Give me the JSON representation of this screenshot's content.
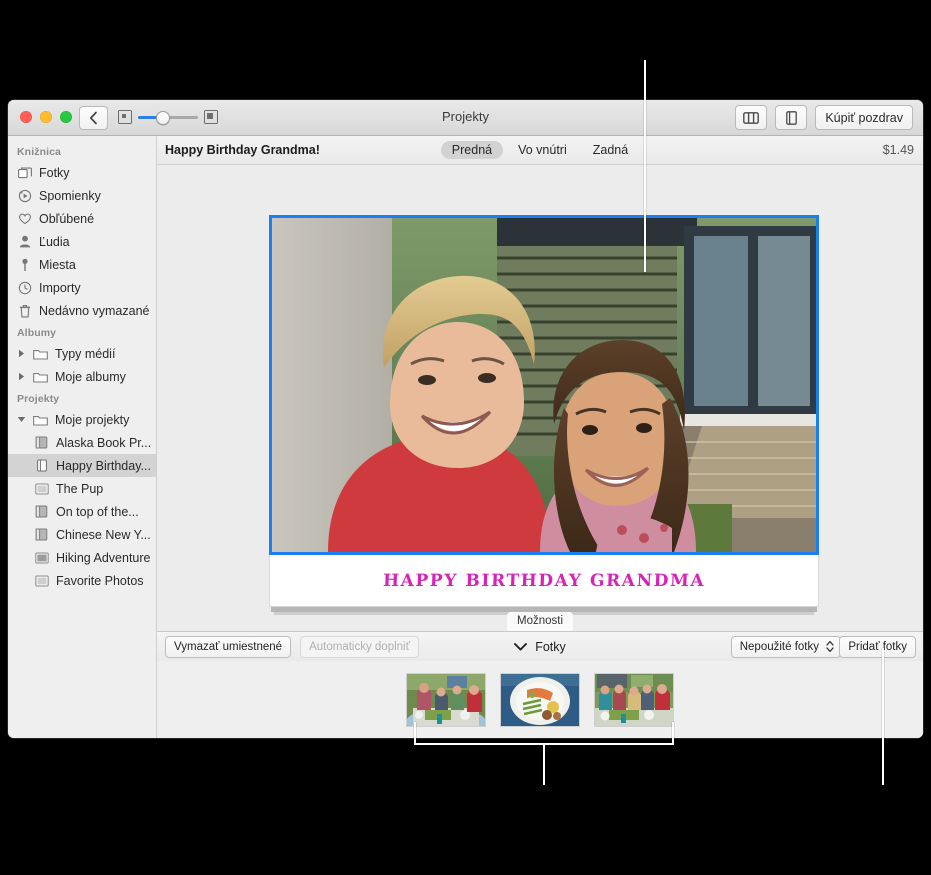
{
  "window": {
    "title": "Projekty",
    "traffic_lights": [
      "close",
      "minimize",
      "zoom"
    ],
    "back_icon": "chevron-left-icon",
    "zoom_slider": {
      "min_icon": "small-thumbnail-icon",
      "max_icon": "large-thumbnail-icon",
      "value_percent": 33
    },
    "toolbar_right": {
      "split_view_icon": "sidebar-split-icon",
      "card_preview_icon": "folded-card-icon",
      "buy_label": "Kúpiť pozdrav"
    }
  },
  "sidebar": {
    "sections": [
      {
        "header": "Knižnica",
        "items": [
          {
            "label": "Fotky",
            "icon": "photos-stack-icon"
          },
          {
            "label": "Spomienky",
            "icon": "memories-play-icon"
          },
          {
            "label": "Obľúbené",
            "icon": "heart-icon"
          },
          {
            "label": "Ľudia",
            "icon": "person-icon"
          },
          {
            "label": "Miesta",
            "icon": "map-pin-icon"
          },
          {
            "label": "Importy",
            "icon": "clock-import-icon"
          },
          {
            "label": "Nedávno vymazané",
            "icon": "trash-icon"
          }
        ]
      },
      {
        "header": "Albumy",
        "items": [
          {
            "label": "Typy médií",
            "icon": "folder-icon",
            "twisty": "collapsed"
          },
          {
            "label": "Moje albumy",
            "icon": "folder-icon",
            "twisty": "collapsed"
          }
        ]
      },
      {
        "header": "Projekty",
        "items": [
          {
            "label": "Moje projekty",
            "icon": "folder-icon",
            "twisty": "expanded"
          },
          {
            "label": "Alaska Book Pr...",
            "icon": "book-icon",
            "indent": true
          },
          {
            "label": "Happy Birthday...",
            "icon": "card-icon",
            "indent": true,
            "selected": true
          },
          {
            "label": "The Pup",
            "icon": "print-icon",
            "indent": true
          },
          {
            "label": "On top of the...",
            "icon": "book-icon",
            "indent": true
          },
          {
            "label": "Chinese New Y...",
            "icon": "book-icon",
            "indent": true
          },
          {
            "label": "Hiking Adventure",
            "icon": "slideshow-icon",
            "indent": true
          },
          {
            "label": "Favorite Photos",
            "icon": "print-icon",
            "indent": true
          }
        ]
      }
    ]
  },
  "main": {
    "project_name": "Happy Birthday Grandma!",
    "segments": [
      {
        "label": "Predná",
        "selected": true
      },
      {
        "label": "Vo vnútri",
        "selected": false
      },
      {
        "label": "Zadná",
        "selected": false
      }
    ],
    "price": "$1.49",
    "card": {
      "greeting_text": "HAPPY BIRTHDAY GRANDMA",
      "greeting_color": "#d822b8",
      "border_color": "#1a7ef5",
      "photo_alt": "grandmother-and-granddaughter-photo"
    },
    "options_tab": "Možnosti"
  },
  "bottom_bar": {
    "clear_placed": "Vymazať umiestnené",
    "autofill": "Automaticky doplniť",
    "autofill_disabled": true,
    "photos_label": "Fotky",
    "photos_disclosure_icon": "chevron-down-icon",
    "filter_value": "Nepoužité fotky",
    "filter_icon": "up-down-chevrons-icon",
    "add_photos": "Pridať fotky"
  },
  "tray": {
    "thumbnails": [
      {
        "name": "thumbnail-dinner-party-1"
      },
      {
        "name": "thumbnail-plated-salmon"
      },
      {
        "name": "thumbnail-dinner-party-2"
      }
    ]
  },
  "callouts": [
    {
      "name": "callout-line-card-photo"
    },
    {
      "name": "callout-bracket-photo-tray"
    },
    {
      "name": "callout-line-add-photos"
    }
  ]
}
